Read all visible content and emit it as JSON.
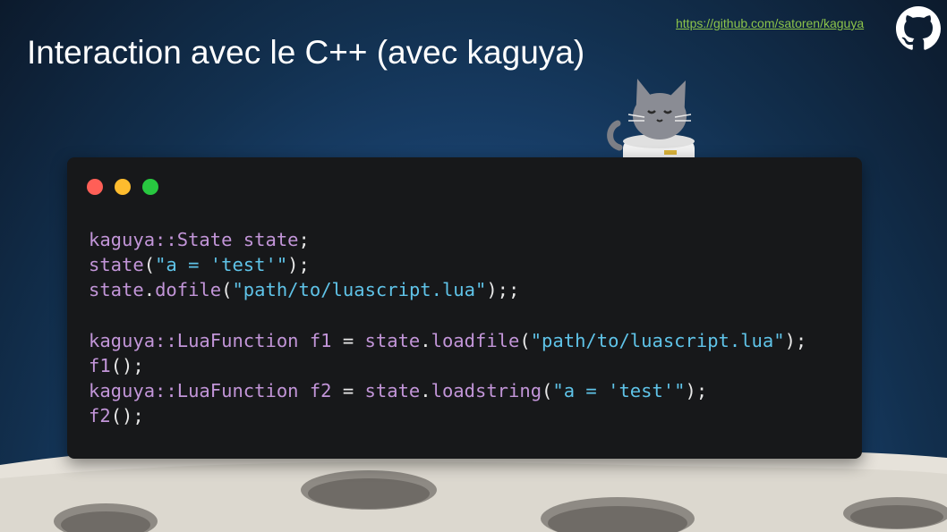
{
  "slide": {
    "title": "Interaction avec le C++ (avec kaguya)",
    "link": "https://github.com/satoren/kaguya",
    "github_icon": "github-octocat-icon",
    "mascot_icon": "cat-astronaut-icon"
  },
  "window": {
    "controls": [
      {
        "name": "close",
        "color": "#ff5f57"
      },
      {
        "name": "minimize",
        "color": "#febc2e"
      },
      {
        "name": "maximize",
        "color": "#28c840"
      }
    ]
  },
  "code": {
    "colors": {
      "identifier": "#c295d8",
      "string": "#5fc3e8",
      "punctuation": "#e8e8e8"
    },
    "lines": [
      [
        {
          "t": "kaguya::State state",
          "c": "pl"
        },
        {
          "t": ";",
          "c": "pu"
        }
      ],
      [
        {
          "t": "state",
          "c": "pl"
        },
        {
          "t": "(",
          "c": "pu"
        },
        {
          "t": "\"a = 'test'\"",
          "c": "st"
        },
        {
          "t": ");",
          "c": "pu"
        }
      ],
      [
        {
          "t": "state",
          "c": "pl"
        },
        {
          "t": ".",
          "c": "pu"
        },
        {
          "t": "dofile",
          "c": "pl"
        },
        {
          "t": "(",
          "c": "pu"
        },
        {
          "t": "\"path/to/luascript.lua\"",
          "c": "st"
        },
        {
          "t": ");;",
          "c": "pu"
        }
      ],
      [],
      [
        {
          "t": "kaguya::LuaFunction f1 ",
          "c": "pl"
        },
        {
          "t": "=",
          "c": "pu"
        },
        {
          "t": " state",
          "c": "pl"
        },
        {
          "t": ".",
          "c": "pu"
        },
        {
          "t": "loadfile",
          "c": "pl"
        },
        {
          "t": "(",
          "c": "pu"
        },
        {
          "t": "\"path/to/luascript.lua\"",
          "c": "st"
        },
        {
          "t": ");",
          "c": "pu"
        }
      ],
      [
        {
          "t": "f1",
          "c": "pl"
        },
        {
          "t": "();",
          "c": "pu"
        }
      ],
      [
        {
          "t": "kaguya::LuaFunction f2 ",
          "c": "pl"
        },
        {
          "t": "=",
          "c": "pu"
        },
        {
          "t": " state",
          "c": "pl"
        },
        {
          "t": ".",
          "c": "pu"
        },
        {
          "t": "loadstring",
          "c": "pl"
        },
        {
          "t": "(",
          "c": "pu"
        },
        {
          "t": "\"a = 'test'\"",
          "c": "st"
        },
        {
          "t": ");",
          "c": "pu"
        }
      ],
      [
        {
          "t": "f2",
          "c": "pl"
        },
        {
          "t": "();",
          "c": "pu"
        }
      ]
    ]
  }
}
